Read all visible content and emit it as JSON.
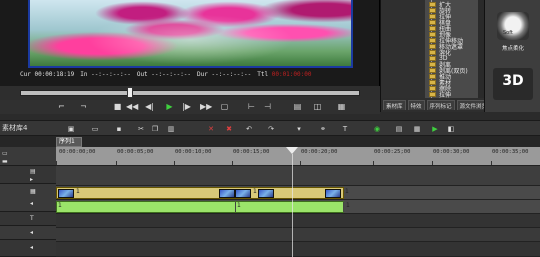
{
  "preview": {
    "timecodes": [
      {
        "label": "Cur",
        "value": "00:00:18:19",
        "color": "#e0e0e0"
      },
      {
        "label": "In",
        "value": "--:--:--:--",
        "color": "#e0e0e0"
      },
      {
        "label": "Out",
        "value": "--:--:--:--",
        "color": "#e0e0e0"
      },
      {
        "label": "Dur",
        "value": "--:--:--:--",
        "color": "#e0e0e0"
      },
      {
        "label": "Ttl",
        "value": "00:01:00:00",
        "color": "#c02020"
      }
    ]
  },
  "library": {
    "tree": [
      "扩大",
      "旋转",
      "拉伸",
      "棋盘",
      "扭曲",
      "划像",
      "拉伸移动",
      "移动遮罩",
      "溶化",
      "3D",
      "剥离",
      "剥离(双页)",
      "推动",
      "素材",
      "擦除",
      "拉伸"
    ],
    "tabs": [
      "素材库",
      "特效",
      "序列标记",
      "源文件浏览"
    ]
  },
  "effects": {
    "soft_label": "Soft",
    "soft_caption": "焦点柔化",
    "three_d_label": "3D"
  },
  "bin": {
    "label": "素材库4"
  },
  "sequence": {
    "tab_label": "序列1"
  },
  "ruler": {
    "ticks": [
      "00:00:00;00",
      "00:00:05;00",
      "00:00:10;00",
      "00:00:15;00",
      "00:00:20;00",
      "00:00:25;00",
      "00:00:30;00",
      "00:00:35;00"
    ]
  },
  "tracks": {
    "video_clip_label": "1",
    "audio_clip_label": "1"
  },
  "colors": {
    "accent_play": "#3fd13f",
    "clip_video": "#d9c978",
    "clip_audio": "#9be46a",
    "frame_border": "#1b3aa0"
  }
}
